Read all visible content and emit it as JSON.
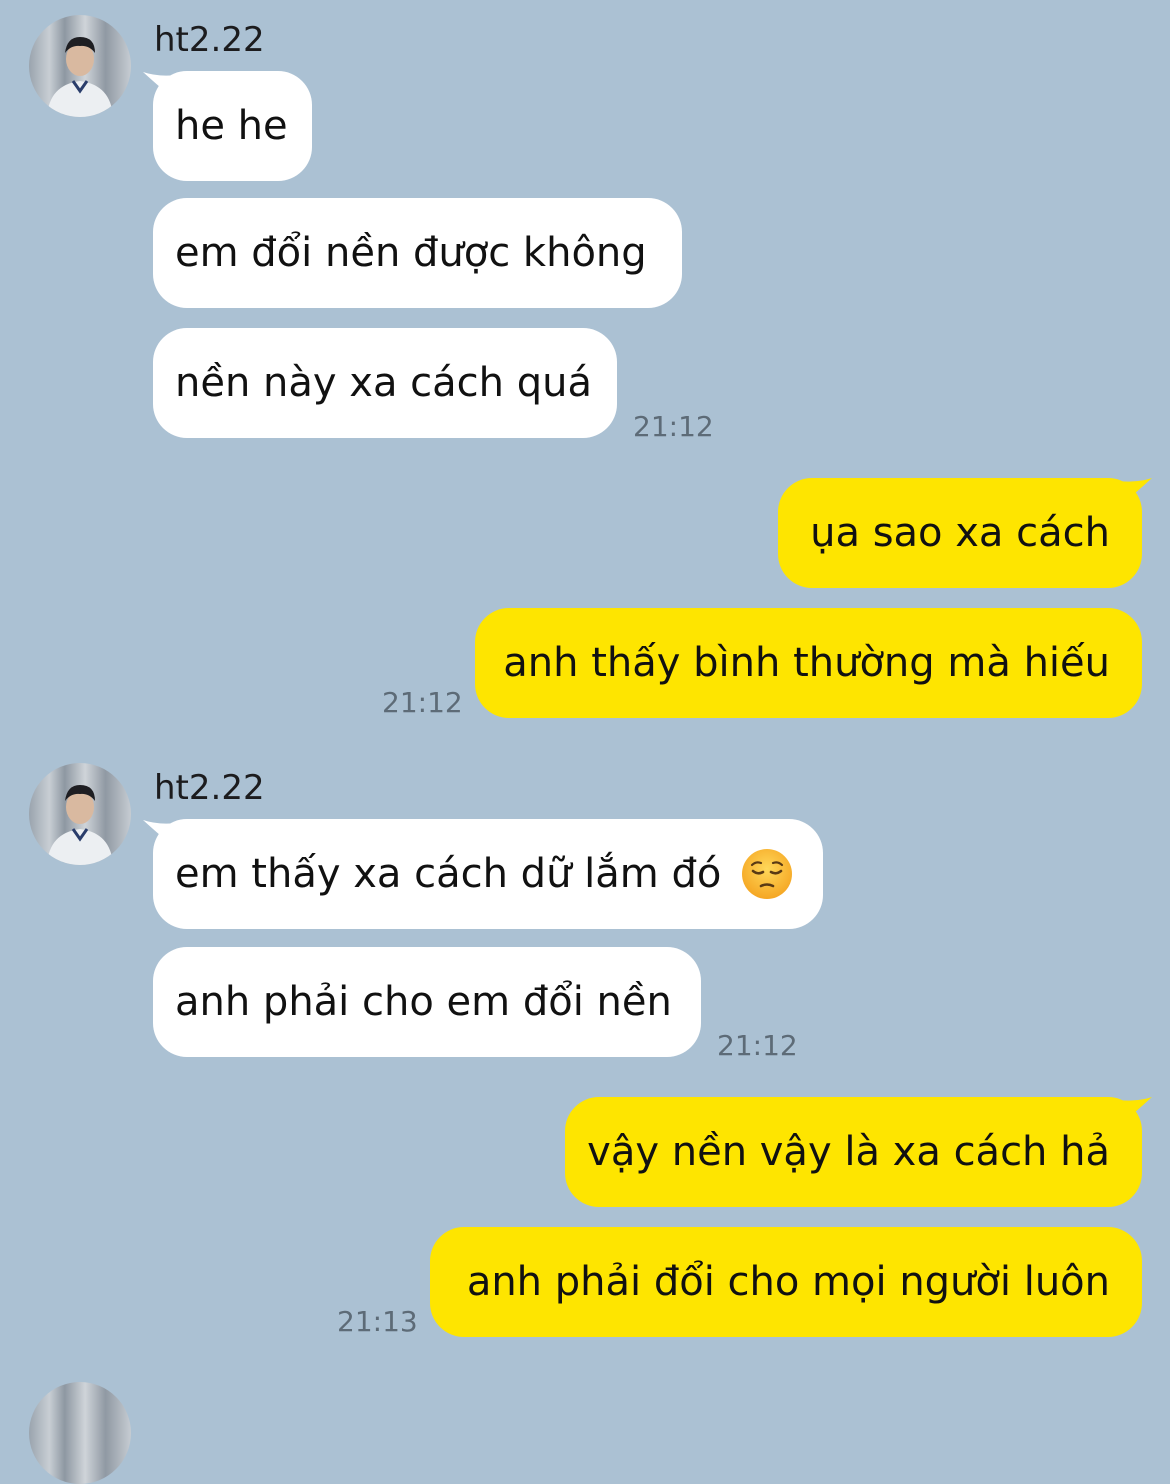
{
  "colors": {
    "background": "#abc1d3",
    "incoming_bubble": "#ffffff",
    "outgoing_bubble": "#fee500",
    "timestamp": "#5d6b77"
  },
  "groups": [
    {
      "sender": "ht2.22",
      "avatar_icon": "profile-photo",
      "messages": [
        "he he",
        "em đổi nền được không",
        "nền này xa cách quá"
      ],
      "time": "21:12"
    },
    {
      "sender": "me",
      "messages": [
        "ụa sao xa cách",
        "anh thấy bình thường mà hiếu"
      ],
      "time": "21:12"
    },
    {
      "sender": "ht2.22",
      "avatar_icon": "profile-photo",
      "messages": [
        "em thấy xa cách dữ lắm đó",
        "anh phải cho em đổi nền"
      ],
      "emoji": "pensive-face-emoji",
      "time": "21:12"
    },
    {
      "sender": "me",
      "messages": [
        "vậy nền vậy là xa cách hả",
        "anh phải đổi cho mọi người luôn"
      ],
      "time": "21:13"
    }
  ]
}
